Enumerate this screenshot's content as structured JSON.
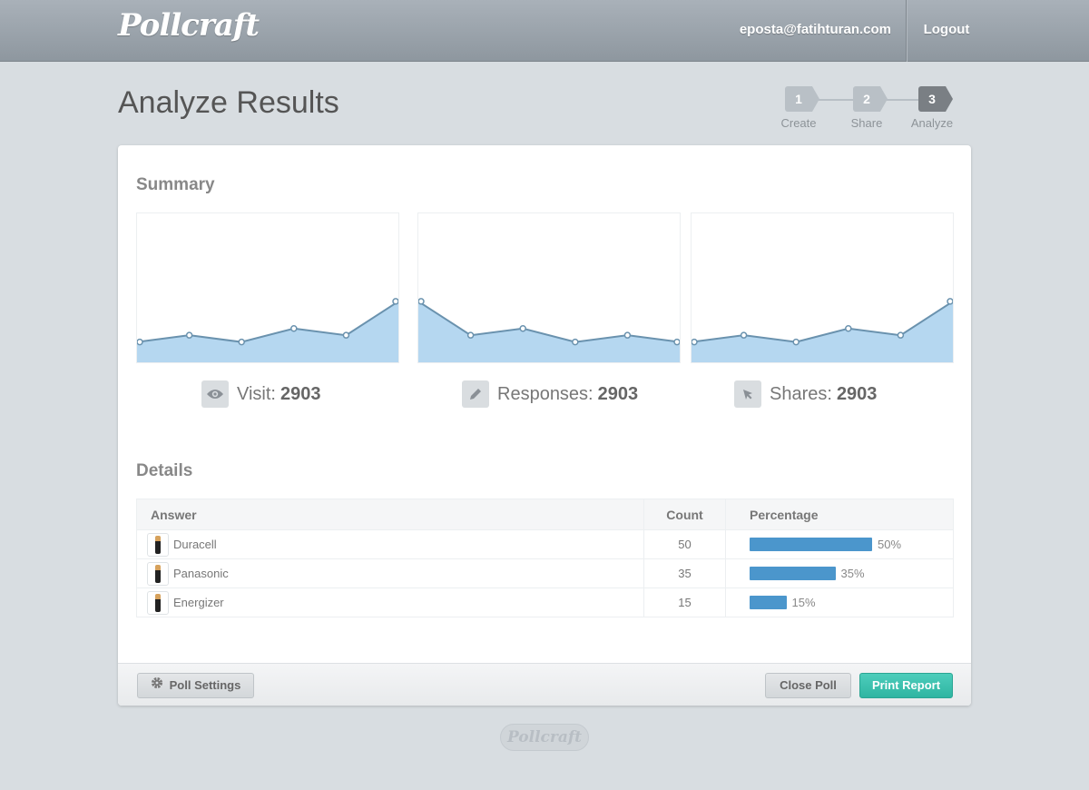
{
  "app": {
    "logo": "Pollcraft"
  },
  "nav": {
    "email": "eposta@fatihturan.com",
    "logout": "Logout"
  },
  "page": {
    "title": "Analyze Results"
  },
  "steps": [
    {
      "number": "1",
      "label": "Create"
    },
    {
      "number": "2",
      "label": "Share"
    },
    {
      "number": "3",
      "label": "Analyze",
      "active": true
    }
  ],
  "summary": {
    "title": "Summary",
    "stats": [
      {
        "icon": "eye-icon",
        "label": "Visit:",
        "value": "2903"
      },
      {
        "icon": "pencil-icon",
        "label": "Responses:",
        "value": "2903"
      },
      {
        "icon": "cursor-icon",
        "label": "Shares:",
        "value": "2903"
      }
    ]
  },
  "chart_data": [
    {
      "type": "area",
      "series": [
        {
          "values": [
            3,
            4,
            3,
            5,
            4,
            9
          ]
        }
      ],
      "ylim": [
        0,
        22
      ],
      "color": "#b5d7f0",
      "line_color": "#6a92ae"
    },
    {
      "type": "area",
      "series": [
        {
          "values": [
            9,
            4,
            5,
            3,
            4,
            3
          ]
        }
      ],
      "ylim": [
        0,
        22
      ],
      "color": "#b5d7f0",
      "line_color": "#6a92ae"
    },
    {
      "type": "area",
      "series": [
        {
          "values": [
            3,
            4,
            3,
            5,
            4,
            9
          ]
        }
      ],
      "ylim": [
        0,
        22
      ],
      "color": "#b5d7f0",
      "line_color": "#6a92ae"
    }
  ],
  "details": {
    "title": "Details",
    "headers": {
      "answer": "Answer",
      "count": "Count",
      "percentage": "Percentage"
    },
    "rows": [
      {
        "answer": "Duracell",
        "count": "50",
        "percentage": 50,
        "percentage_label": "50%"
      },
      {
        "answer": "Panasonic",
        "count": "35",
        "percentage": 35,
        "percentage_label": "35%"
      },
      {
        "answer": "Energizer",
        "count": "15",
        "percentage": 15,
        "percentage_label": "15%"
      }
    ]
  },
  "actions": {
    "settings": "Poll Settings",
    "close": "Close Poll",
    "print": "Print Report"
  },
  "footer": {
    "logo": "Pollcraft"
  },
  "colors": {
    "accent": "#4b96cc",
    "print_button": "#3cc1ae",
    "chart_fill": "#b5d7f0"
  }
}
